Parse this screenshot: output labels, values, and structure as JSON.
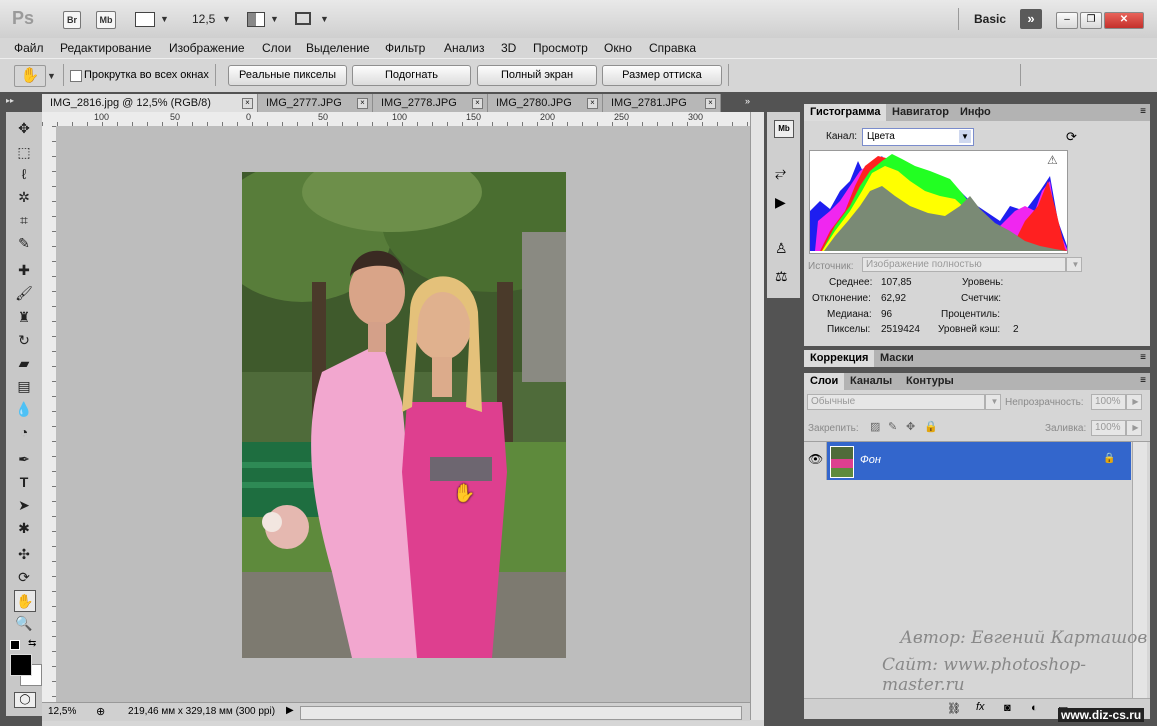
{
  "titlebar": {
    "logo": "Ps",
    "br_label": "Br",
    "mb_label": "Mb",
    "zoom": "12,5",
    "workspace": "Basic",
    "expand": "»",
    "minimize": "–",
    "restore": "❐",
    "close": "✕"
  },
  "menu": [
    "Файл",
    "Редактирование",
    "Изображение",
    "Слои",
    "Выделение",
    "Фильтр",
    "Анализ",
    "3D",
    "Просмотр",
    "Окно",
    "Справка"
  ],
  "options": {
    "scroll_all_label": "Прокрутка во всех окнах",
    "buttons": [
      "Реальные пикселы",
      "Подогнать",
      "Полный экран",
      "Размер оттиска"
    ]
  },
  "tabs": [
    {
      "label": "IMG_2816.jpg @ 12,5% (RGB/8)",
      "active": true
    },
    {
      "label": "IMG_2777.JPG",
      "active": false
    },
    {
      "label": "IMG_2778.JPG",
      "active": false
    },
    {
      "label": "IMG_2780.JPG",
      "active": false
    },
    {
      "label": "IMG_2781.JPG",
      "active": false
    }
  ],
  "ruler_ticks": [
    "100",
    "50",
    "0",
    "50",
    "100",
    "150",
    "200",
    "250",
    "300"
  ],
  "status": {
    "zoom": "12,5%",
    "doc_size": "219,46 мм x 329,18 мм (300 ppi)"
  },
  "histogram_panel": {
    "tabs": [
      "Гистограмма",
      "Навигатор",
      "Инфо"
    ],
    "channel_label": "Канал:",
    "channel_value": "Цвета",
    "source_label": "Источник:",
    "source_value": "Изображение полностью",
    "stats_left": [
      {
        "label": "Среднее:",
        "value": "107,85"
      },
      {
        "label": "Отклонение:",
        "value": "62,92"
      },
      {
        "label": "Медиана:",
        "value": "96"
      },
      {
        "label": "Пикселы:",
        "value": "2519424"
      }
    ],
    "stats_right": [
      {
        "label": "Уровень:",
        "value": ""
      },
      {
        "label": "Счетчик:",
        "value": ""
      },
      {
        "label": "Процентиль:",
        "value": ""
      },
      {
        "label": "Уровней кэш:",
        "value": "2"
      }
    ]
  },
  "adjust_panel": {
    "tabs": [
      "Коррекция",
      "Маски"
    ]
  },
  "layers_panel": {
    "tabs": [
      "Слои",
      "Каналы",
      "Контуры"
    ],
    "blend_mode": "Обычные",
    "opacity_label": "Непрозрачность:",
    "opacity_value": "100%",
    "lock_label": "Закрепить:",
    "fill_label": "Заливка:",
    "fill_value": "100%",
    "layer_name": "Фон"
  },
  "credit": {
    "author": "Автор: Евгений Карташов",
    "site": "Сайт: www.photoshop-master.ru"
  },
  "watermark": "www.diz-cs.ru",
  "colors": {
    "layer_selected": "#3366cc",
    "dark_ui": "#535353",
    "histogram_fill": "#7a8a75"
  }
}
